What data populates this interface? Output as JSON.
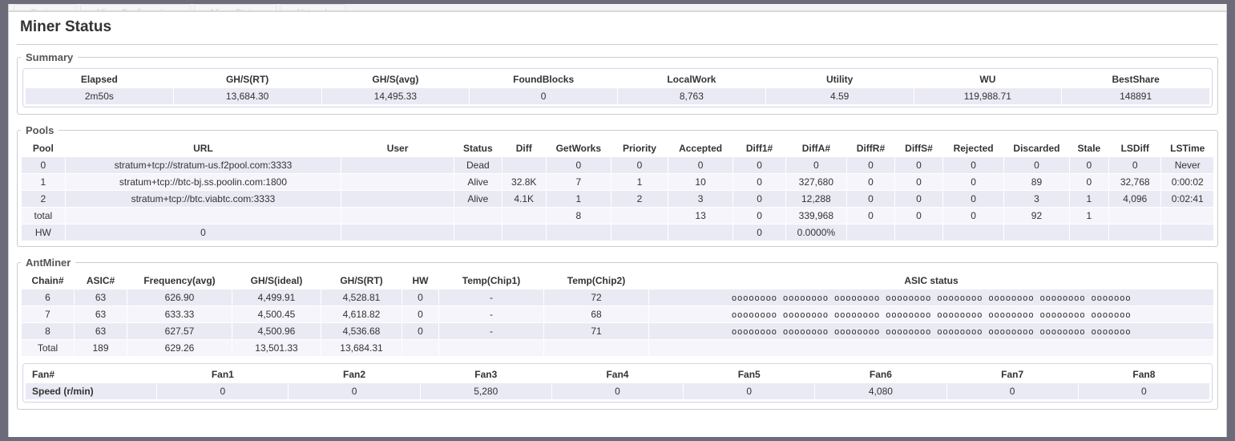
{
  "tabs": [
    "System",
    "Miner Configuration",
    "Miner Status",
    "Network"
  ],
  "page_title": "Miner Status",
  "summary": {
    "legend": "Summary",
    "headers": [
      "Elapsed",
      "GH/S(RT)",
      "GH/S(avg)",
      "FoundBlocks",
      "LocalWork",
      "Utility",
      "WU",
      "BestShare"
    ],
    "row": [
      "2m50s",
      "13,684.30",
      "14,495.33",
      "0",
      "8,763",
      "4.59",
      "119,988.71",
      "148891"
    ]
  },
  "pools": {
    "legend": "Pools",
    "headers": [
      "Pool",
      "URL",
      "User",
      "Status",
      "Diff",
      "GetWorks",
      "Priority",
      "Accepted",
      "Diff1#",
      "DiffA#",
      "DiffR#",
      "DiffS#",
      "Rejected",
      "Discarded",
      "Stale",
      "LSDiff",
      "LSTime"
    ],
    "rows": [
      [
        "0",
        "stratum+tcp://stratum-us.f2pool.com:3333",
        "",
        "Dead",
        "",
        "0",
        "0",
        "0",
        "0",
        "0",
        "0",
        "0",
        "0",
        "0",
        "0",
        "0",
        "Never"
      ],
      [
        "1",
        "stratum+tcp://btc-bj.ss.poolin.com:1800",
        "",
        "Alive",
        "32.8K",
        "7",
        "1",
        "10",
        "0",
        "327,680",
        "0",
        "0",
        "0",
        "89",
        "0",
        "32,768",
        "0:00:02"
      ],
      [
        "2",
        "stratum+tcp://btc.viabtc.com:3333",
        "",
        "Alive",
        "4.1K",
        "1",
        "2",
        "3",
        "0",
        "12,288",
        "0",
        "0",
        "0",
        "3",
        "1",
        "4,096",
        "0:02:41"
      ],
      [
        "total",
        "",
        "",
        "",
        "",
        "8",
        "",
        "13",
        "0",
        "339,968",
        "0",
        "0",
        "0",
        "92",
        "1",
        "",
        ""
      ],
      [
        "HW",
        "0",
        "",
        "",
        "",
        "",
        "",
        "",
        "0",
        "0.0000%",
        "",
        "",
        "",
        "",
        "",
        "",
        ""
      ]
    ]
  },
  "antminer": {
    "legend": "AntMiner",
    "headers": [
      "Chain#",
      "ASIC#",
      "Frequency(avg)",
      "GH/S(ideal)",
      "GH/S(RT)",
      "HW",
      "Temp(Chip1)",
      "Temp(Chip2)",
      "ASIC status"
    ],
    "rows": [
      [
        "6",
        "63",
        "626.90",
        "4,499.91",
        "4,528.81",
        "0",
        "-",
        "72",
        "oooooooo oooooooo oooooooo oooooooo oooooooo oooooooo oooooooo ooooooo"
      ],
      [
        "7",
        "63",
        "633.33",
        "4,500.45",
        "4,618.82",
        "0",
        "-",
        "68",
        "oooooooo oooooooo oooooooo oooooooo oooooooo oooooooo oooooooo ooooooo"
      ],
      [
        "8",
        "63",
        "627.57",
        "4,500.96",
        "4,536.68",
        "0",
        "-",
        "71",
        "oooooooo oooooooo oooooooo oooooooo oooooooo oooooooo oooooooo ooooooo"
      ],
      [
        "Total",
        "189",
        "629.26",
        "13,501.33",
        "13,684.31",
        "",
        "",
        "",
        ""
      ]
    ],
    "fan_headers": [
      "Fan#",
      "Fan1",
      "Fan2",
      "Fan3",
      "Fan4",
      "Fan5",
      "Fan6",
      "Fan7",
      "Fan8"
    ],
    "fan_row": [
      "Speed (r/min)",
      "0",
      "0",
      "5,280",
      "0",
      "0",
      "4,080",
      "0",
      "0"
    ]
  }
}
